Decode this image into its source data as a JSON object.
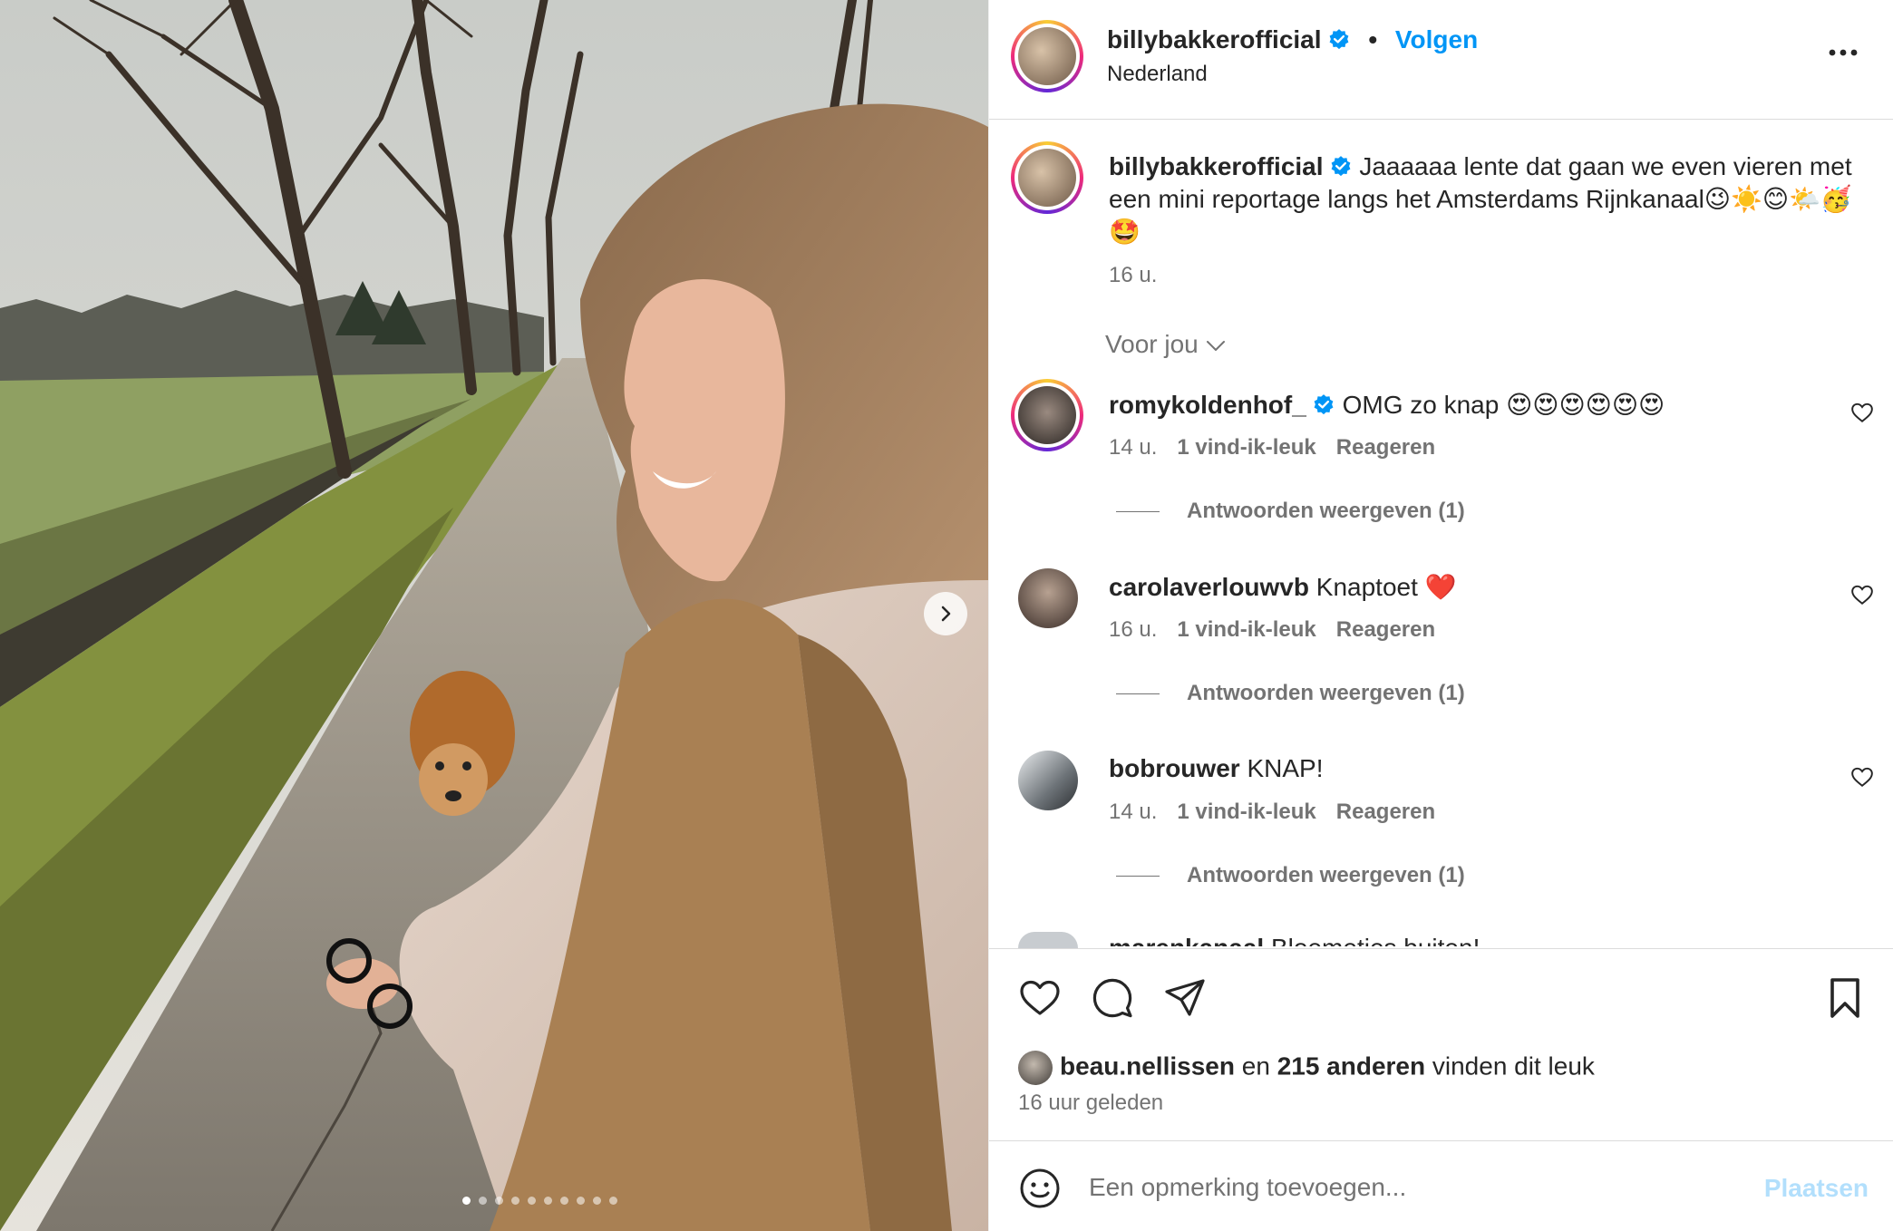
{
  "post": {
    "username": "billybakkerofficial",
    "follow_label": "Volgen",
    "location": "Nederland",
    "caption": "Jaaaaaa lente dat gaan we even vieren met een mini reportage langs het Amsterdams Rijnkanaal😉☀️😊🌤️🥳🤩",
    "caption_time": "16 u.",
    "carousel_count": 10,
    "carousel_active_index": 1
  },
  "sort": {
    "label": "Voor jou"
  },
  "comments": [
    {
      "user": "romykoldenhof_",
      "verified": true,
      "text": "OMG zo knap 😍😍😍😍😍😍",
      "time": "14 u.",
      "likes": "1 vind-ik-leuk",
      "reply": "Reageren",
      "view_replies": "Antwoorden weergeven (1)"
    },
    {
      "user": "carolaverlouwvb",
      "verified": false,
      "text": "Knaptoet ❤️",
      "time": "16 u.",
      "likes": "1 vind-ik-leuk",
      "reply": "Reageren",
      "view_replies": "Antwoorden weergeven (1)"
    },
    {
      "user": "bobrouwer",
      "verified": false,
      "text": "KNAP!",
      "time": "14 u.",
      "likes": "1 vind-ik-leuk",
      "reply": "Reageren",
      "view_replies": "Antwoorden weergeven (1)"
    }
  ],
  "partial_comment": {
    "user": "marenkanaal",
    "text": "Bloemetjes buiten!"
  },
  "likes": {
    "first_user": "beau.nellissen",
    "joiner": "en",
    "count": "215 anderen",
    "suffix": "vinden dit leuk"
  },
  "posted_ago": "16 uur geleden",
  "composer": {
    "placeholder": "Een opmerking toevoegen...",
    "post_label": "Plaatsen"
  },
  "icons": [
    "next-arrow-icon",
    "more-icon",
    "verified-icon",
    "heart-icon",
    "comment-icon",
    "share-icon",
    "bookmark-icon",
    "emoji-icon",
    "chevron-down-icon"
  ],
  "colors": {
    "accent": "#0095f6",
    "muted": "#737373",
    "text": "#262626",
    "post_disabled": "#b2dffc"
  }
}
